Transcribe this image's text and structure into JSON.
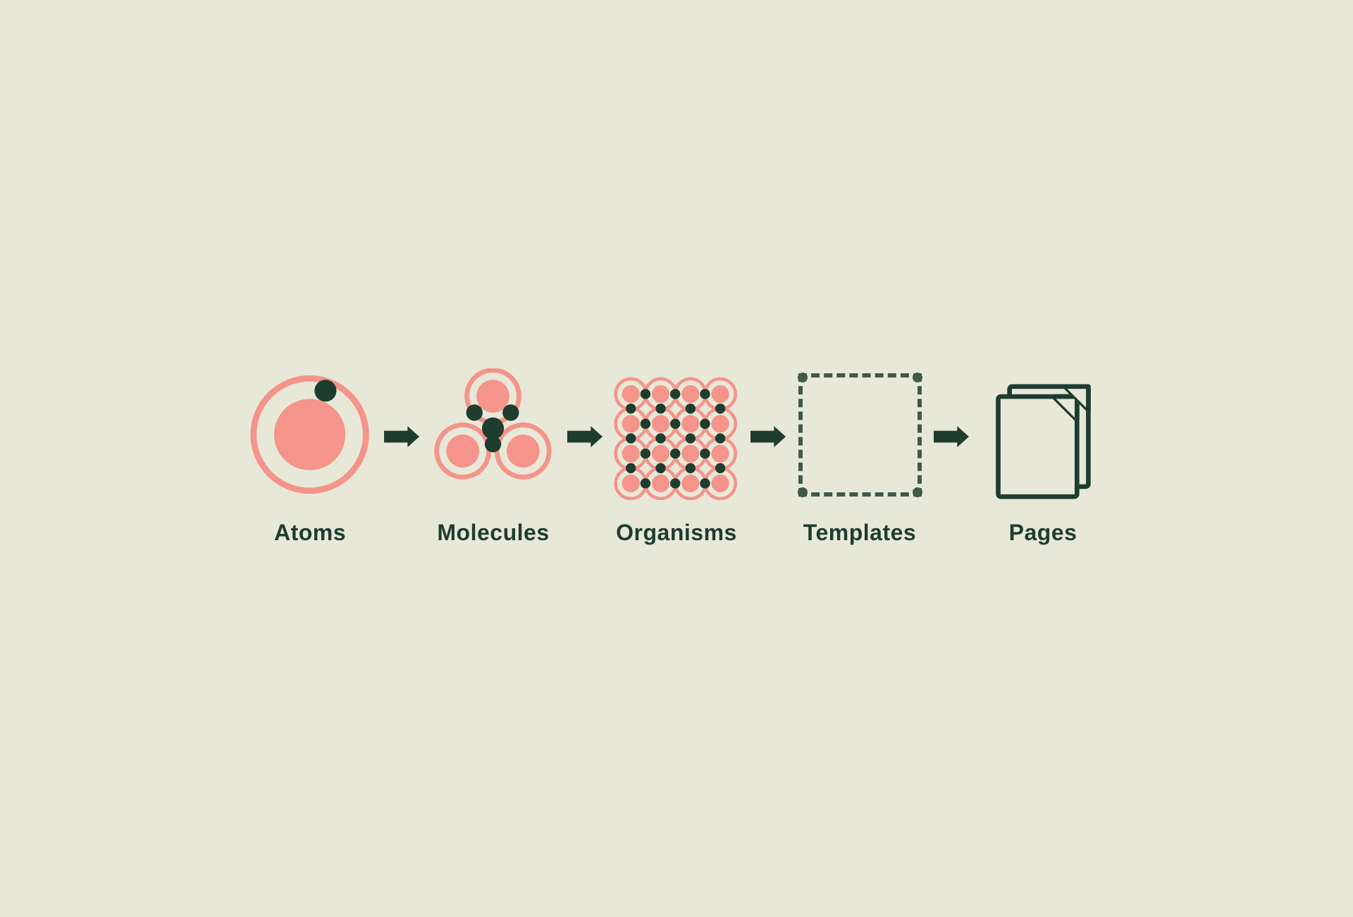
{
  "diagram": {
    "background": "#e8e8d8",
    "dark_color": "#1e3d2f",
    "salmon_color": "#f4948a",
    "steps": [
      {
        "id": "atoms",
        "label": "Atoms"
      },
      {
        "id": "molecules",
        "label": "Molecules"
      },
      {
        "id": "organisms",
        "label": "Organisms"
      },
      {
        "id": "templates",
        "label": "Templates"
      },
      {
        "id": "pages",
        "label": "Pages"
      }
    ]
  }
}
